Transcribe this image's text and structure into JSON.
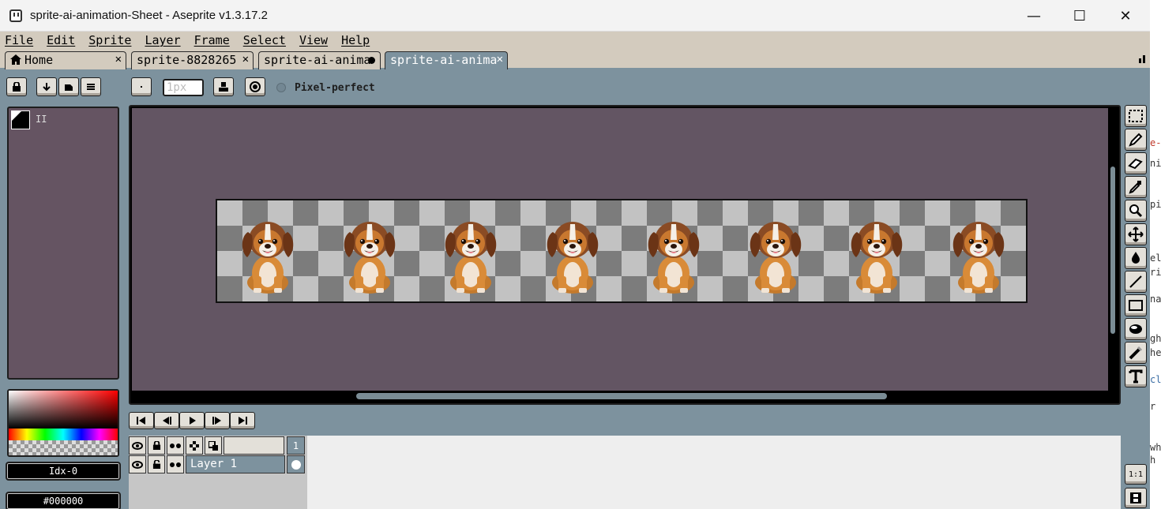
{
  "window": {
    "title": "sprite-ai-animation-Sheet - Aseprite v1.3.17.2",
    "minimize_glyph": "—",
    "maximize_glyph": "☐",
    "close_glyph": "✕"
  },
  "menu": [
    "File",
    "Edit",
    "Sprite",
    "Layer",
    "Frame",
    "Select",
    "View",
    "Help"
  ],
  "tabs": [
    {
      "label": "Home",
      "icon": "home-icon",
      "close": "✕",
      "state": "inactive"
    },
    {
      "label": "sprite-8828265",
      "close": "✕",
      "state": "inactive"
    },
    {
      "label": "sprite-ai-anima",
      "modified": true,
      "state": "inactive"
    },
    {
      "label": "sprite-ai-anima",
      "close": "✕",
      "state": "active"
    }
  ],
  "toolbar": {
    "brush_size_placeholder": "1px",
    "pixel_perfect_label": "Pixel-perfect",
    "pixel_perfect_checked": false
  },
  "left_panel": {
    "fg_color": "#000000",
    "bg_color": "#ffffff",
    "swatch_label": "II",
    "index_field": "Idx-0",
    "hex_field": "#000000"
  },
  "canvas": {
    "background_color": "#635563",
    "frame_count": 8,
    "subject_icon": "puppy-sprite"
  },
  "tools": [
    "rectangle-select-icon",
    "pencil-icon",
    "eraser-icon",
    "eyedropper-icon",
    "zoom-icon",
    "move-icon",
    "fill-icon",
    "line-icon",
    "rectangle-icon",
    "contour-icon",
    "blur-icon",
    "text-icon"
  ],
  "animation_controls": [
    "first-frame",
    "previous-frame",
    "play",
    "next-frame",
    "last-frame"
  ],
  "timeline": {
    "frame_number": "1",
    "layer_name": "Layer 1",
    "zoom_label": "1:1"
  },
  "colors": {
    "accent": "#7d929e",
    "menubar": "#d3cbbe",
    "panel_bg": "#655462",
    "button_face": "#e3e0d9"
  }
}
